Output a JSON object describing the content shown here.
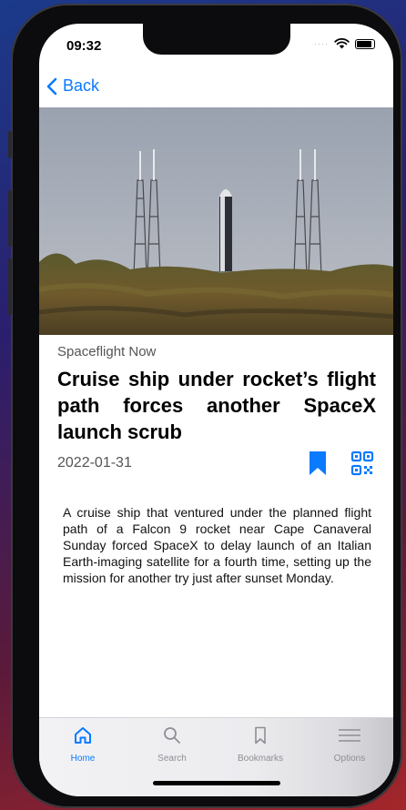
{
  "status": {
    "time": "09:32",
    "signal_dots": "····"
  },
  "nav": {
    "back_label": "Back"
  },
  "article": {
    "source": "Spaceflight Now",
    "title": "Cruise ship under rocket’s flight path forces another SpaceX launch scrub",
    "date": "2022-01-31",
    "summary": "A cruise ship that ventured under the planned flight path of a Falcon 9 rocket near Cape Canaveral Sunday forced SpaceX to delay launch of an Italian Earth-imaging satellite for a fourth time, setting up the mission for another try just after sunset Monday."
  },
  "tabs": [
    {
      "label": "Home",
      "icon": "home-icon",
      "active": true
    },
    {
      "label": "Search",
      "icon": "search-icon",
      "active": false
    },
    {
      "label": "Bookmarks",
      "icon": "bookmark-icon",
      "active": false
    },
    {
      "label": "Options",
      "icon": "menu-icon",
      "active": false
    }
  ],
  "colors": {
    "accent": "#0a7aff",
    "inactive": "#8e8e93"
  }
}
